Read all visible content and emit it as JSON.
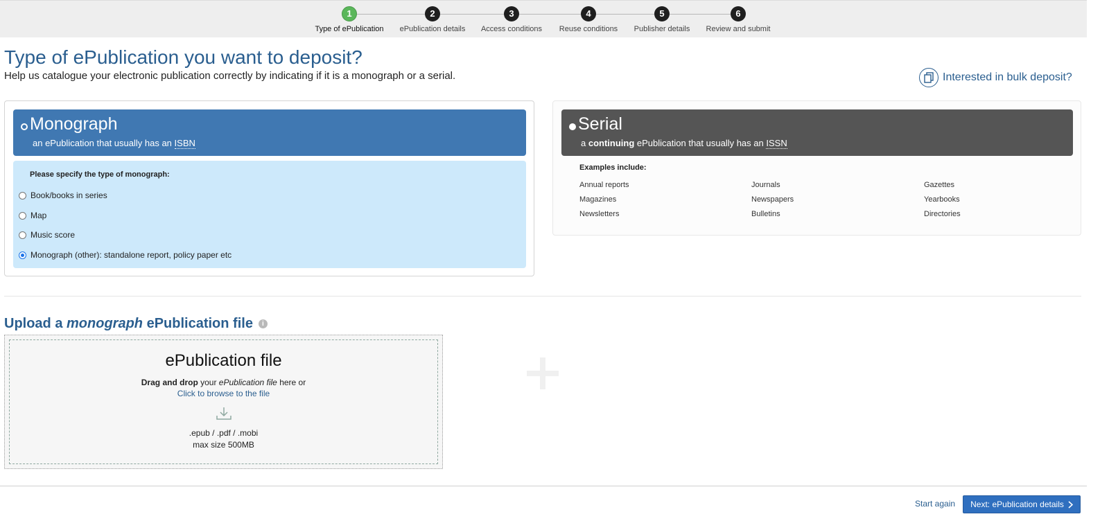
{
  "stepper": {
    "steps": [
      {
        "num": "1",
        "label": "Type of ePublication"
      },
      {
        "num": "2",
        "label": "ePublication details"
      },
      {
        "num": "3",
        "label": "Access conditions"
      },
      {
        "num": "4",
        "label": "Reuse conditions"
      },
      {
        "num": "5",
        "label": "Publisher details"
      },
      {
        "num": "6",
        "label": "Review and submit"
      }
    ],
    "active_color": "#5bb75b"
  },
  "header": {
    "title": "Type of ePublication you want to deposit?",
    "subtitle": "Help us catalogue your electronic publication correctly by indicating if it is a monograph or a serial.",
    "bulk_link": "Interested in bulk deposit?"
  },
  "monograph": {
    "title": "Monograph",
    "desc_prefix": "an ePublication that usually has an ",
    "desc_abbr": "ISBN",
    "prompt": "Please specify the type of monograph:",
    "options": [
      {
        "label": "Book/books in series",
        "checked": false
      },
      {
        "label": "Map",
        "checked": false
      },
      {
        "label": "Music score",
        "checked": false
      },
      {
        "label": "Monograph (other): standalone report, policy paper etc",
        "checked": true
      }
    ],
    "accent": "#4078b2"
  },
  "serial": {
    "title": "Serial",
    "desc_a": "a ",
    "desc_bold": "continuing",
    "desc_b": " ePublication that usually has an ",
    "desc_abbr": "ISSN",
    "examples_title": "Examples include:",
    "examples": [
      "Annual reports",
      "Journals",
      "Gazettes",
      "Magazines",
      "Newspapers",
      "Yearbooks",
      "Newsletters",
      "Bulletins",
      "Directories"
    ],
    "accent": "#555555"
  },
  "upload": {
    "title_a": "Upload a ",
    "title_em": "monograph",
    "title_b": " ePublication file",
    "info": "i",
    "drop_title": "ePublication file",
    "drop_bold": "Drag and drop",
    "drop_mid": " your ",
    "drop_em": "ePublication file",
    "drop_end": " here or",
    "browse": "Click to browse to the file",
    "types": ".epub / .pdf / .mobi",
    "max_size": "max size 500MB"
  },
  "footer": {
    "start_again": "Start again",
    "next": "Next: ePublication details"
  }
}
